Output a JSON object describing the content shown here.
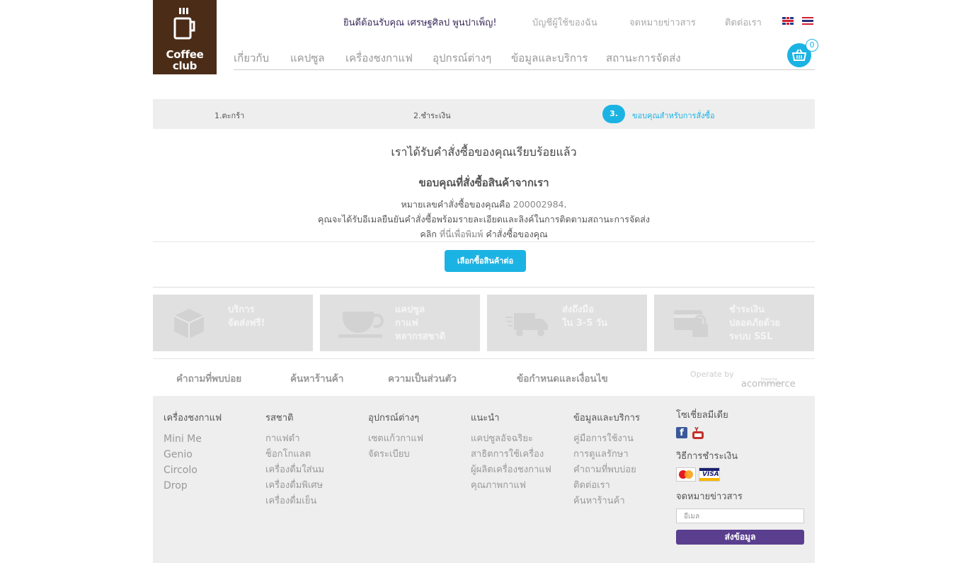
{
  "brand": {
    "line1": "Coffee",
    "line2": "club"
  },
  "top_links": {
    "welcome": "ยินดีต้อนรับคุณ เศรษฐศิลป พูนปาเพ็ญ!",
    "account": "บัญชีผู้ใช้ของฉัน",
    "newsletter": "จดหมายข่าวสาร",
    "contact": "ติดต่อเรา"
  },
  "main_nav": [
    "เกี่ยวกับ",
    "แคปซูล",
    "เครื่องชงกาแฟ",
    "อุปกรณ์ต่างๆ",
    "ข้อมูลและบริการ",
    "สถานะการจัดส่ง"
  ],
  "cart": {
    "count": "0"
  },
  "steps": {
    "step1": "1.ตะกร้า",
    "step2": "2.ชำระเงิน",
    "step3_num": "3.",
    "step3": "ขอบคุณสำหรับการสั่งซื้อ"
  },
  "confirmation": {
    "title": "เราได้รับคำสั่งซื้อของคุณเรียบร้อยแล้ว",
    "thanks": "ขอบคุณที่สั่งซื้อสินค้าจากเรา",
    "order_prefix": "หมายเลขคำสั่งซื้อของคุณคือ",
    "order_number": "200002984",
    "order_suffix": ".",
    "email_note": "คุณจะได้รับอีเมลยืนยันคำสั่งซื้อพร้อมรายละเอียดและลิงค์ในการติดตามสถานะการจัดส่ง",
    "click": "คลิก",
    "print_link": "ที่นี่เพื่อพิมพ์",
    "print_suffix": "คำสั่งซื้อของคุณ",
    "continue_button": "เลือกซื้อสินค้าต่อ"
  },
  "features": [
    {
      "text": "บริการ\nจัดส่งฟรี!",
      "icon": "box-icon"
    },
    {
      "text": "แคปซูล\nกาแฟ\nหลากรสชาติ",
      "icon": "coffee-cup-icon"
    },
    {
      "text": "ส่งถึงมือ\nใน 3-5 วัน",
      "icon": "truck-icon"
    },
    {
      "text": "ชำระเงิน\nปลอดภัยด้วย\nระบบ SSL",
      "icon": "secure-card-icon"
    }
  ],
  "footer_links": {
    "faq": "คำถามที่พบบ่อย",
    "store": "ค้นหาร้านค้า",
    "privacy": "ความเป็นส่วนตัว",
    "terms": "ข้อกำหนดและเงื่อนไข",
    "operate_by": "Operate by",
    "acommerce": "acommerce",
    "acommerce_tag": "Powering eCommerce"
  },
  "footer": {
    "machines": {
      "title": "เครื่องชงกาแฟ",
      "items": [
        "Mini Me",
        "Genio",
        "Circolo",
        "Drop"
      ]
    },
    "flavors": {
      "title": "รสชาติ",
      "items": [
        "กาแฟดำ",
        "ช็อกโกแลต",
        "เครื่องดื่มใส่นม",
        "เครื่องดื่มพิเศษ",
        "เครื่องดื่มเย็น"
      ]
    },
    "accessories": {
      "title": "อุปกรณ์ต่างๆ",
      "items": [
        "เซตแก้วกาแฟ",
        "จัดระเบียบ"
      ]
    },
    "recommend": {
      "title": "แนะนำ",
      "items": [
        "แคปซูลอัจฉริยะ",
        "สาธิตการใช้เครื่อง",
        "ผู้ผลิตเครื่องชงกาแฟ",
        "คุณภาพกาแฟ"
      ]
    },
    "services": {
      "title": "ข้อมูลและบริการ",
      "items": [
        "คู่มือการใช้งาน",
        "การดูแลรักษา",
        "คำถามที่พบบ่อย",
        "ติดต่อเรา",
        "ค้นหาร้านค้า"
      ]
    },
    "social_title": "โซเชี่ยลมีเดีย",
    "payment_title": "วิธีการชำระเงิน",
    "visa": "VISA",
    "newsletter_title": "จดหมายข่าวสาร",
    "email_placeholder": "อีเมล",
    "send_button": "ส่งข้อมูล"
  },
  "colors": {
    "brand_brown": "#4a2c17",
    "accent_blue": "#1bb3e3",
    "purple_button": "#5a3f8f"
  }
}
